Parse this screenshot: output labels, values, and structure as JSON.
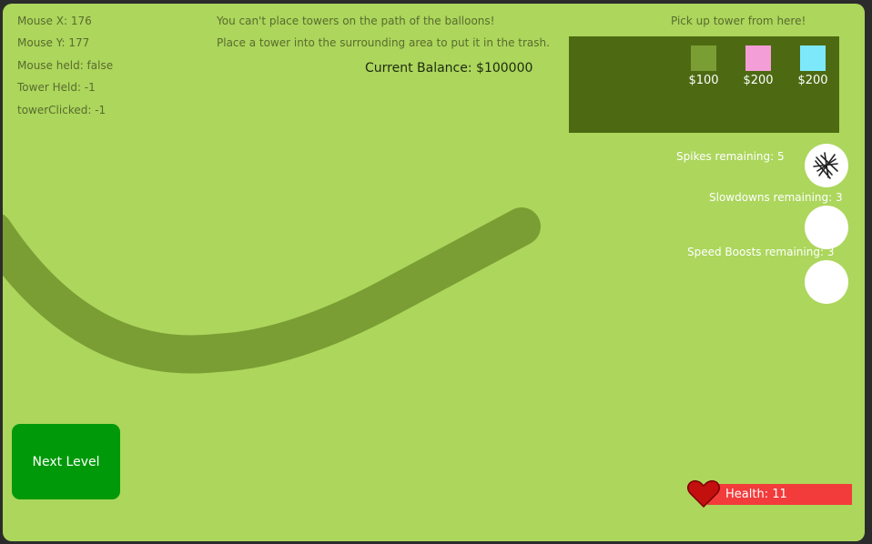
{
  "debug": {
    "mouse_x": "Mouse X: 176",
    "mouse_y": "Mouse Y: 177",
    "mouse_held": "Mouse held: false",
    "tower_held": "Tower Held: -1",
    "tower_clicked": "towerClicked: -1"
  },
  "messages": {
    "path_warning": "You can't place towers on the path of the balloons!",
    "trash_hint": "Place a tower into the surrounding area to put it in the trash.",
    "balance": "Current Balance: $100000",
    "pickup": "Pick up tower from here!"
  },
  "shop": {
    "towers": [
      {
        "price": "$100",
        "color": "#7a9e34"
      },
      {
        "price": "$200",
        "color": "#f49ed8"
      },
      {
        "price": "$200",
        "color": "#7ee8fb"
      }
    ]
  },
  "abilities": {
    "spikes": "Spikes remaining: 5",
    "slowdowns": "Slowdowns remaining: 3",
    "speed_boosts": "Speed Boosts remaining: 3"
  },
  "next_level": "Next Level",
  "health": {
    "label": "Health:  11",
    "bar_color": "#f23b3b"
  },
  "colors": {
    "background": "#acd65c",
    "path": "#7a9e34",
    "shop_panel": "#4d6a12",
    "next_button": "#00990a"
  }
}
